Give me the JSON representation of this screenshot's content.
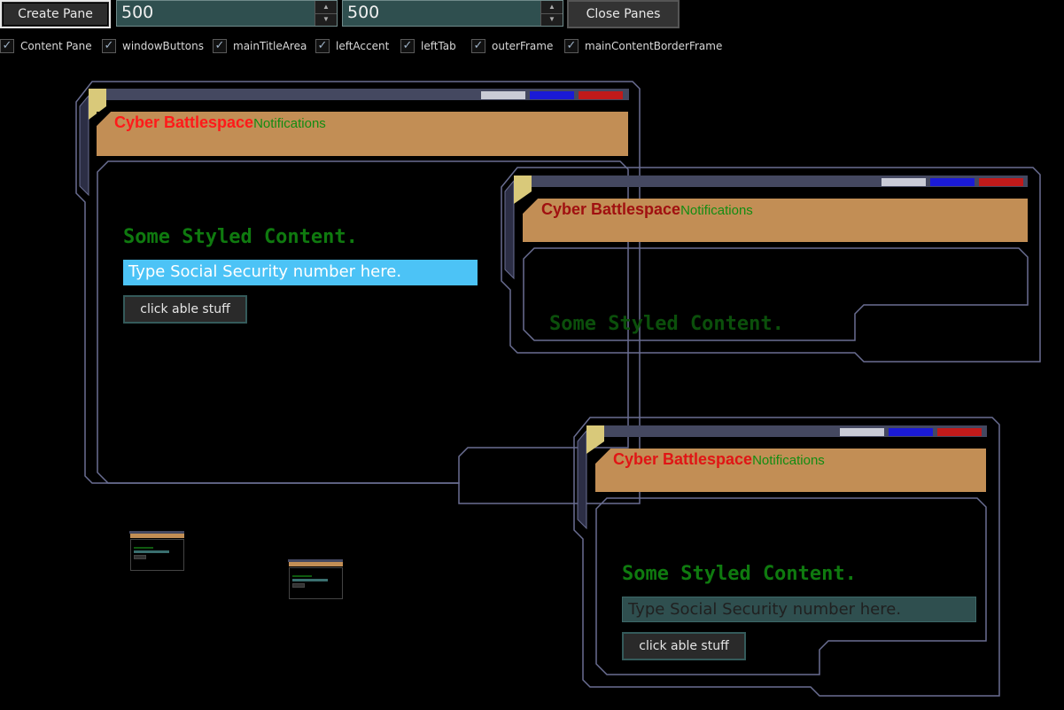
{
  "toolbar": {
    "create_label": "Create Pane",
    "width_value": "500",
    "height_value": "500",
    "close_label": "Close Panes",
    "checkboxes": [
      {
        "label": "Content Pane",
        "checked": true
      },
      {
        "label": "windowButtons",
        "checked": true
      },
      {
        "label": "mainTitleArea",
        "checked": true
      },
      {
        "label": "leftAccent",
        "checked": true
      },
      {
        "label": "leftTab",
        "checked": true
      },
      {
        "label": "outerFrame",
        "checked": true
      },
      {
        "label": "mainContentBorderFrame",
        "checked": true
      }
    ]
  },
  "pane": {
    "title": "Cyber Battlespace",
    "subtitle": "Notifications",
    "content_text": "Some Styled Content.",
    "input_placeholder": "Type Social Security number here.",
    "button_label": "click able stuff"
  },
  "colors": {
    "background": "#000000",
    "frame_stroke": "#6a6e92",
    "title_bar": "#c28e55",
    "title_red": "#ff1a1a",
    "subtitle_green": "#128c12",
    "content_green": "#0f7a0f",
    "input_blue": "#4cc3f6",
    "accent_yellow": "#d9c97a",
    "win_btn_white": "#c9cbd6",
    "win_btn_blue": "#1a1ad6",
    "win_btn_red": "#c01a1a"
  }
}
